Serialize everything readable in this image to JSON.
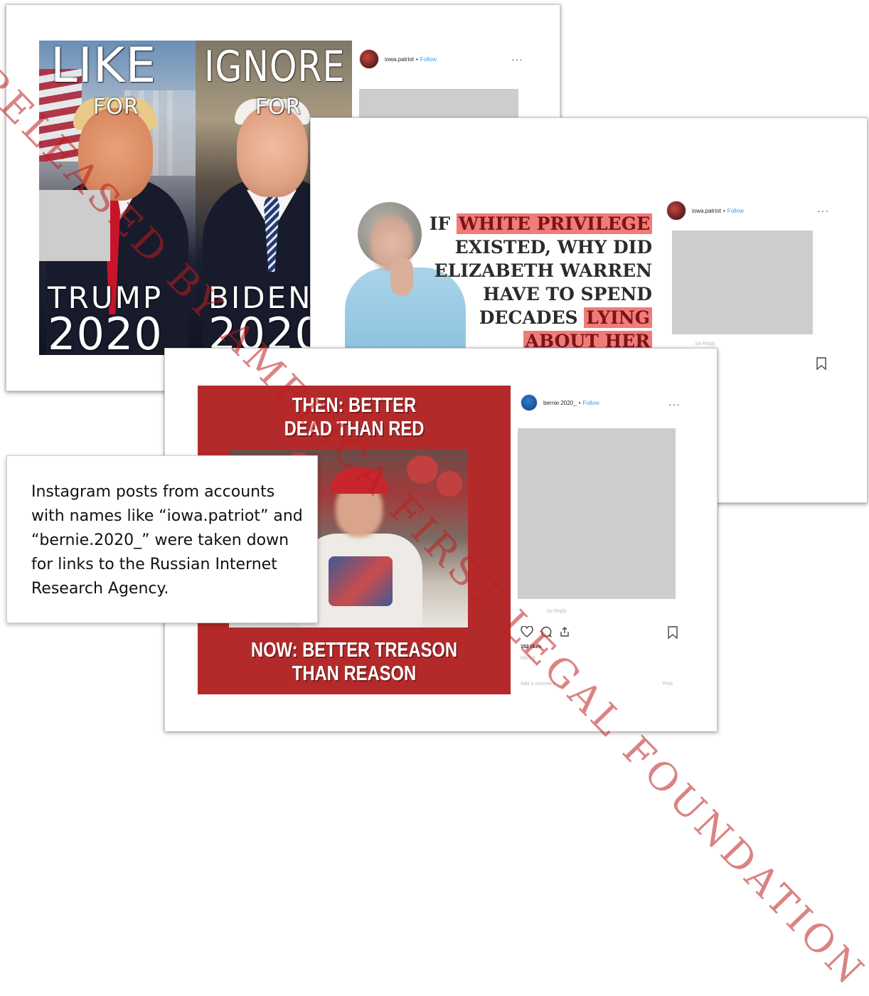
{
  "card1": {
    "meme": {
      "like": "LIKE",
      "ignore": "IGNORE",
      "for_left": "FOR",
      "for_right": "FOR",
      "name_left": "TRUMP",
      "name_right": "BIDEN",
      "year_left": "2020",
      "year_right": "2020"
    },
    "header": {
      "username": "iowa.patriot",
      "dot": "•",
      "follow": "Follow",
      "more": "···"
    }
  },
  "card2": {
    "meme": {
      "lines": [
        {
          "pre": "IF ",
          "hl": "WHITE PRIVILEGE",
          "post": ""
        },
        {
          "pre": "EXISTED, WHY DID",
          "hl": "",
          "post": ""
        },
        {
          "pre": "ELIZABETH WARREN",
          "hl": "",
          "post": ""
        },
        {
          "pre": "HAVE TO SPEND",
          "hl": "",
          "post": ""
        },
        {
          "pre": "DECADES ",
          "hl": "LYING",
          "post": ""
        },
        {
          "pre": "",
          "hl": "ABOUT HER",
          "post": ""
        }
      ]
    },
    "header": {
      "username": "iowa.patriot",
      "dot": "•",
      "follow": "Follow",
      "more": "···"
    },
    "faint_1": "1w Reply"
  },
  "card3": {
    "meme": {
      "top_line1": "THEN: BETTER",
      "top_line2": "DEAD THAN RED",
      "bottom_line1": "NOW: BETTER TREASON",
      "bottom_line2": "THAN REASON"
    },
    "header": {
      "username": "bernie.2020_",
      "dot": "•",
      "follow": "Follow",
      "more": "···"
    },
    "faint_reply": "1w Reply",
    "likes": "152 likes",
    "faint_date": "MAY 9",
    "faint_comment": "Add a comment...",
    "faint_post": "Post"
  },
  "caption": {
    "text": "Instagram posts from accounts with names like “iowa.patriot” and “bernie.2020_” were taken down for links to the Russian Internet Research Agency."
  },
  "watermark": "RELEASED BY AMERICA FIRST LEGAL FOUNDATION",
  "colors": {
    "highlight": "#f07b78",
    "meme3_red": "#b42a2a",
    "follow_blue": "#3897f0",
    "watermark": "#be1e1e"
  }
}
